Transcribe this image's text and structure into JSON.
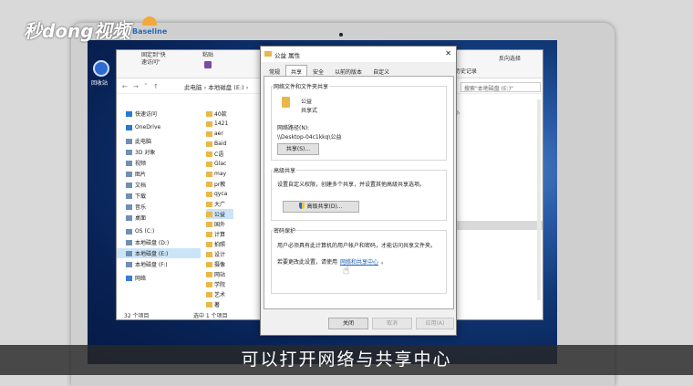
{
  "watermark": {
    "brand": "秒dong视频",
    "partner": "Baseline"
  },
  "desktop": {
    "icon_label": "回收站"
  },
  "explorer": {
    "ribbon": [
      "固定到\"快\n速访问\"",
      "粘贴",
      "历史记录",
      "反向选择"
    ],
    "address": "此电脑 › 本地磁盘 (E:) ›",
    "search_placeholder": "搜索\"本地磁盘 (E:)\"",
    "column_size": "大小",
    "sidebar": [
      {
        "label": "快速访问",
        "icon": "star-icon"
      },
      {
        "label": "OneDrive",
        "icon": "cloud-icon"
      },
      {
        "label": "此电脑",
        "icon": "pc-icon"
      },
      {
        "label": "3D 对象",
        "icon": "cube-icon"
      },
      {
        "label": "视频",
        "icon": "video-icon"
      },
      {
        "label": "图片",
        "icon": "picture-icon"
      },
      {
        "label": "文档",
        "icon": "document-icon"
      },
      {
        "label": "下载",
        "icon": "download-icon"
      },
      {
        "label": "音乐",
        "icon": "music-icon"
      },
      {
        "label": "桌面",
        "icon": "desktop-icon"
      },
      {
        "label": "OS (C:)",
        "icon": "drive-icon"
      },
      {
        "label": "本地磁盘 (D:)",
        "icon": "drive-icon"
      },
      {
        "label": "本地磁盘 (E:)",
        "icon": "drive-icon",
        "selected": true
      },
      {
        "label": "本地磁盘 (F:)",
        "icon": "drive-icon"
      },
      {
        "label": "网络",
        "icon": "network-icon"
      }
    ],
    "files": [
      "40款",
      "1421",
      "aer",
      "Baid",
      "C语",
      "Glac",
      "may",
      "pr教",
      "qyca",
      "大广",
      "公益",
      "国外",
      "计算",
      "拍照",
      "设计",
      "摄像",
      "网站",
      "学院",
      "艺术",
      "著"
    ],
    "status_count": "32 个项目",
    "status_selected": "选中 1 个项目"
  },
  "dialog": {
    "title": "公益 属性",
    "close_glyph": "✕",
    "tabs": [
      "常规",
      "共享",
      "安全",
      "以前的版本",
      "自定义"
    ],
    "active_tab": 1,
    "network_group_title": "网络文件和文件夹共享",
    "share_name": "公益",
    "share_state": "共享式",
    "network_path_label": "网络路径(N):",
    "network_path": "\\\\Desktop-04c1kkq\\公益",
    "share_button": "共享(S)...",
    "advanced_group_title": "高级共享",
    "advanced_desc": "设置自定义权限，创建多个共享，并设置其他高级共享选项。",
    "advanced_button": "高级共享(D)...",
    "password_group_title": "密码保护",
    "password_desc": "用户必须具有此计算机的用户帐户和密码，才能访问共享文件夹。",
    "change_prefix": "若要更改此设置，请使用",
    "change_link": "网络和共享中心",
    "change_suffix": "。",
    "ok": "关闭",
    "cancel": "取消",
    "apply": "应用(A)"
  },
  "subtitle": "可以打开网络与共享中心"
}
